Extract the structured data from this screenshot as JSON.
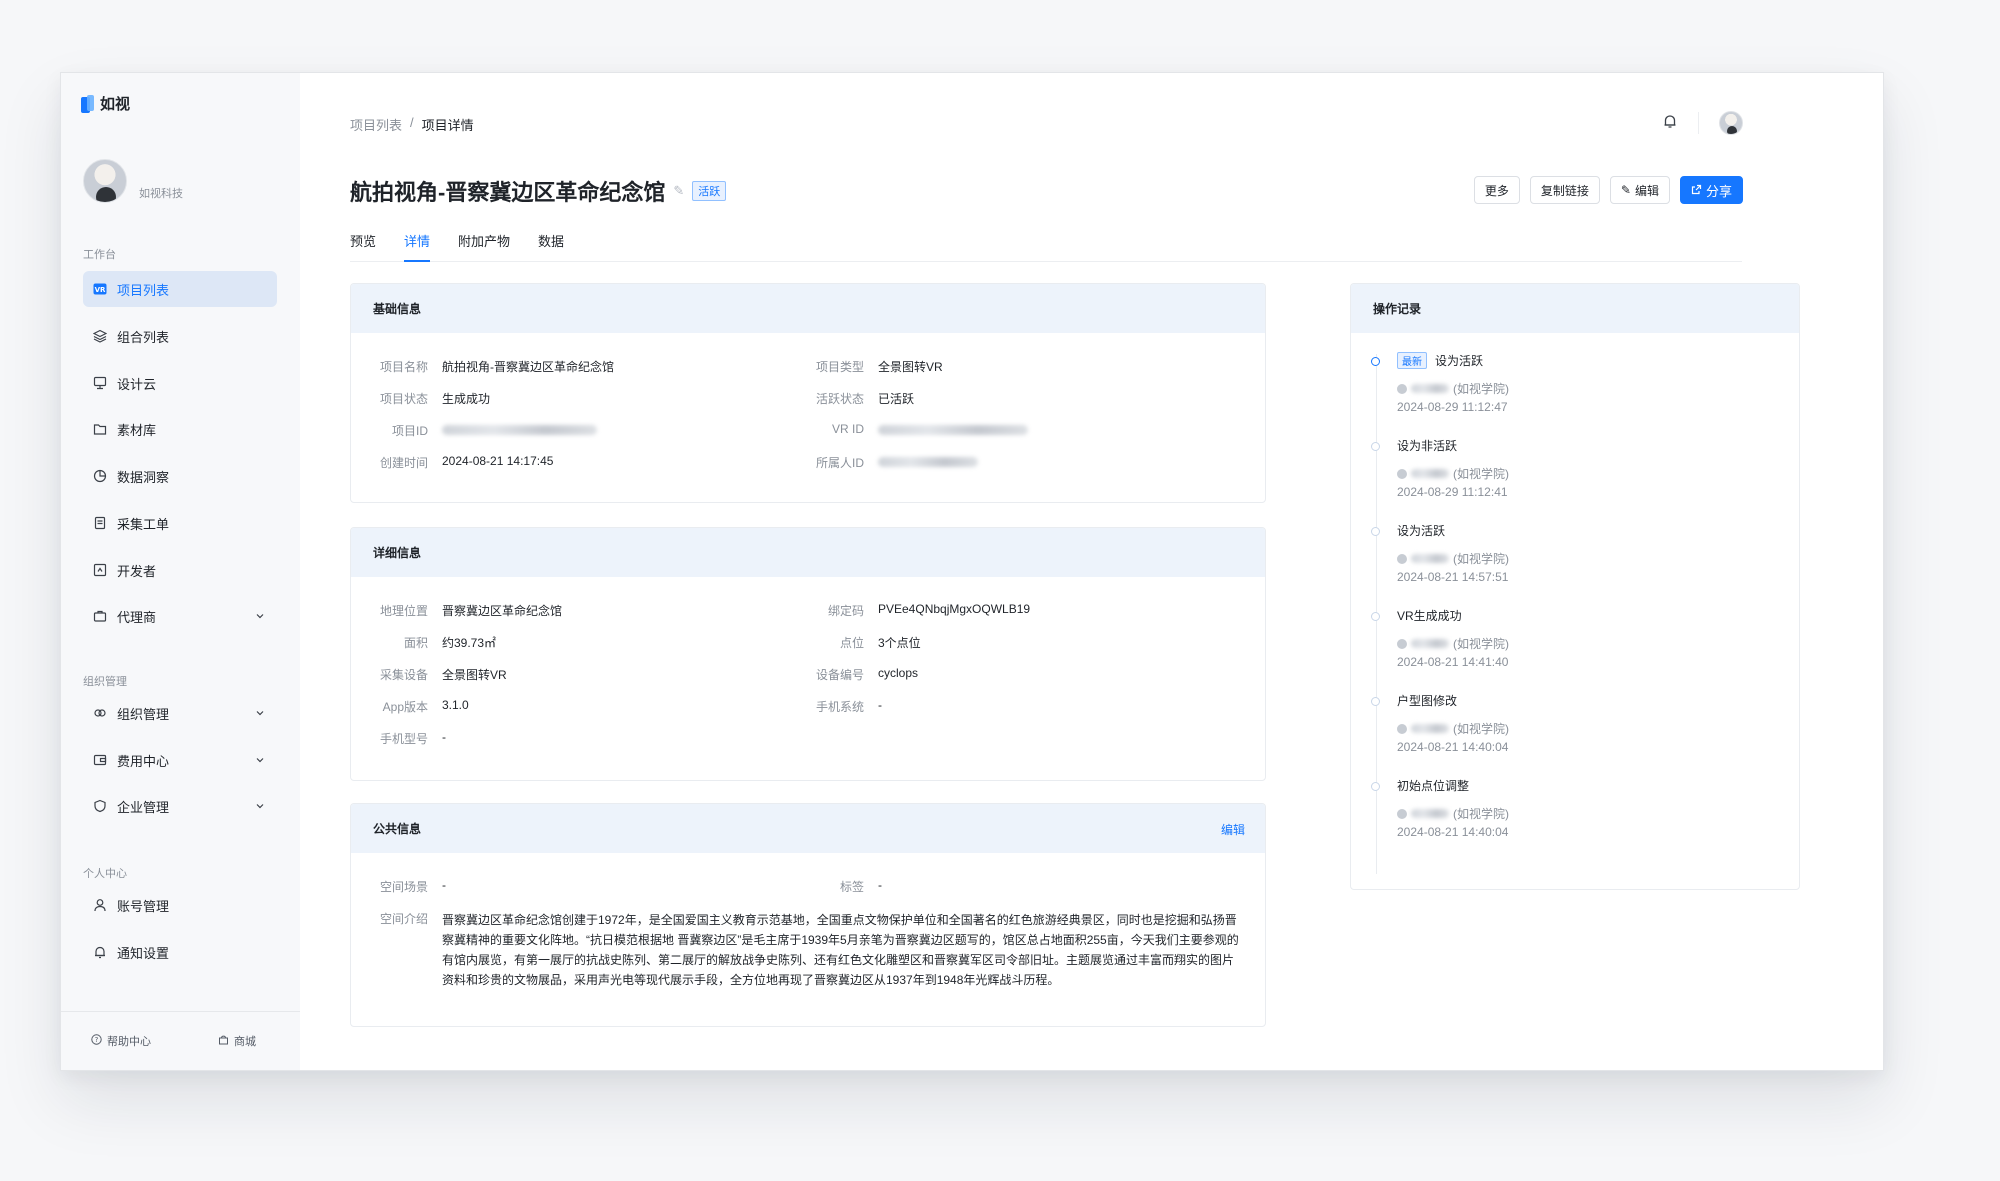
{
  "app": {
    "name": "如视"
  },
  "user": {
    "name": "如视科技"
  },
  "sidebar": {
    "sections": [
      {
        "label": "工作台"
      },
      {
        "label": "组织管理"
      },
      {
        "label": "个人中心"
      }
    ],
    "items": [
      {
        "label": "项目列表",
        "icon": "vr-icon",
        "active": true
      },
      {
        "label": "组合列表",
        "icon": "layers-icon"
      },
      {
        "label": "设计云",
        "icon": "monitor-icon"
      },
      {
        "label": "素材库",
        "icon": "folder-icon"
      },
      {
        "label": "数据洞察",
        "icon": "pie-chart-icon"
      },
      {
        "label": "采集工单",
        "icon": "document-icon"
      },
      {
        "label": "开发者",
        "icon": "code-icon"
      },
      {
        "label": "代理商",
        "icon": "briefcase-icon"
      },
      {
        "label": "组织管理",
        "icon": "org-icon"
      },
      {
        "label": "费用中心",
        "icon": "wallet-icon"
      },
      {
        "label": "企业管理",
        "icon": "shield-icon"
      },
      {
        "label": "账号管理",
        "icon": "user-icon"
      },
      {
        "label": "通知设置",
        "icon": "bell-icon"
      }
    ],
    "footer": {
      "help": "帮助中心",
      "shop": "商城"
    }
  },
  "breadcrumb": {
    "parent": "项目列表",
    "separator": "/",
    "current": "项目详情"
  },
  "header": {
    "title": "航拍视角-晋察冀边区革命纪念馆",
    "status_badge": "活跃",
    "actions": {
      "more": "更多",
      "copy_link": "复制链接",
      "edit": "编辑",
      "share": "分享"
    }
  },
  "tabs": [
    "预览",
    "详情",
    "附加产物",
    "数据"
  ],
  "basic_info": {
    "title": "基础信息",
    "fields": [
      {
        "label": "项目名称",
        "value": "航拍视角-晋察冀边区革命纪念馆"
      },
      {
        "label": "项目类型",
        "value": "全景图转VR"
      },
      {
        "label": "项目状态",
        "value": "生成成功"
      },
      {
        "label": "活跃状态",
        "value": "已活跃"
      },
      {
        "label": "项目ID",
        "value": ""
      },
      {
        "label": "VR ID",
        "value": ""
      },
      {
        "label": "创建时间",
        "value": "2024-08-21 14:17:45"
      },
      {
        "label": "所属人ID",
        "value": ""
      }
    ]
  },
  "detail_info": {
    "title": "详细信息",
    "fields": [
      {
        "label": "地理位置",
        "value": "晋察冀边区革命纪念馆"
      },
      {
        "label": "绑定码",
        "value": "PVEe4QNbqjMgxOQWLB19"
      },
      {
        "label": "面积",
        "value": "约39.73㎡"
      },
      {
        "label": "点位",
        "value": "3个点位"
      },
      {
        "label": "采集设备",
        "value": "全景图转VR"
      },
      {
        "label": "设备编号",
        "value": "cyclops"
      },
      {
        "label": "App版本",
        "value": "3.1.0"
      },
      {
        "label": "手机系统",
        "value": "-"
      },
      {
        "label": "手机型号",
        "value": "-"
      }
    ]
  },
  "public_info": {
    "title": "公共信息",
    "edit": "编辑",
    "fields": [
      {
        "label": "空间场景",
        "value": "-"
      },
      {
        "label": "标签",
        "value": "-"
      },
      {
        "label": "空间介绍",
        "value": "晋察冀边区革命纪念馆创建于1972年，是全国爱国主义教育示范基地，全国重点文物保护单位和全国著名的红色旅游经典景区，同时也是挖掘和弘扬晋察冀精神的重要文化阵地。“抗日模范根据地 晋冀察边区”是毛主席于1939年5月亲笔为晋察冀边区题写的，馆区总占地面积255亩，今天我们主要参观的有馆内展览，有第一展厅的抗战史陈列、第二展厅的解放战争史陈列、还有红色文化雕塑区和晋察冀军区司令部旧址。主题展览通过丰富而翔实的图片资料和珍贵的文物展品，采用声光电等现代展示手段，全方位地再现了晋察冀边区从1937年到1948年光辉战斗历程。"
      }
    ]
  },
  "operation_log": {
    "title": "操作记录",
    "latest_tag": "最新",
    "entries": [
      {
        "action": "设为活跃",
        "org": "(如视学院)",
        "time": "2024-08-29 11:12:47"
      },
      {
        "action": "设为非活跃",
        "org": "(如视学院)",
        "time": "2024-08-29 11:12:41"
      },
      {
        "action": "设为活跃",
        "org": "(如视学院)",
        "time": "2024-08-21 14:57:51"
      },
      {
        "action": "VR生成成功",
        "org": "(如视学院)",
        "time": "2024-08-21 14:41:40"
      },
      {
        "action": "户型图修改",
        "org": "(如视学院)",
        "time": "2024-08-21 14:40:04"
      },
      {
        "action": "初始点位调整",
        "org": "(如视学院)",
        "time": "2024-08-21 14:40:04"
      }
    ]
  },
  "colors": {
    "accent": "#1677ff",
    "active_bg": "#dde7f6",
    "card_head": "#edf3fb"
  }
}
